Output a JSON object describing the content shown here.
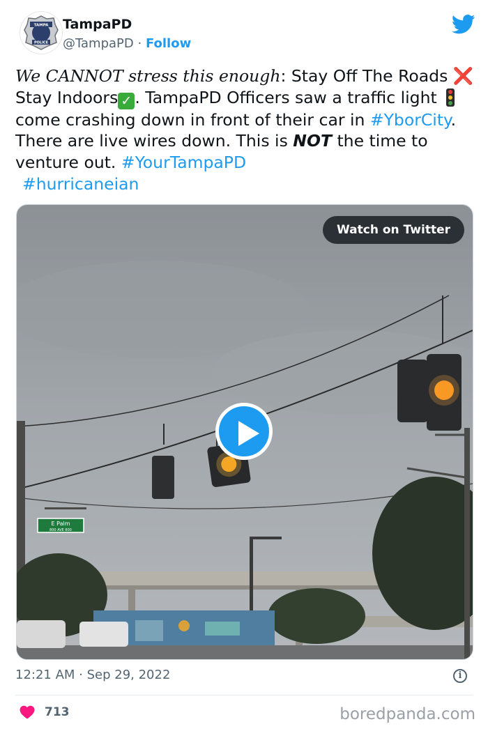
{
  "profile": {
    "name": "TampaPD",
    "handle": "@TampaPD",
    "separator": " · ",
    "follow_label": "Follow",
    "badge_top": "TAMPA",
    "badge_bottom": "POLICE"
  },
  "tweet": {
    "emphasis": "We CANNOT stress this enough",
    "part1": ": Stay Off The Roads ",
    "x_emoji": "❌",
    "part2": " Stay Indoors",
    "check_emoji": "✓",
    "part3": ". TampaPD Officers saw a traffic light ",
    "part4": " come crashing down in front of their car in ",
    "hashtag1": "#YborCity",
    "part5": ". There are live wires down. This is ",
    "not_word": "NOT",
    "part6": " the time to venture out. ",
    "hashtag2": "#YourTampaPD",
    "hashtag3": "#hurricaneian"
  },
  "media": {
    "watch_label": "Watch on Twitter",
    "street_sign": "E Palm",
    "street_sign_sub": "800 AVE 800"
  },
  "footer": {
    "timestamp": "12:21 AM · Sep 29, 2022",
    "info_glyph": "i",
    "like_count": "713",
    "watermark": "boredpanda.com"
  },
  "colors": {
    "accent": "#1d9bf0",
    "like": "#f91880",
    "text": "#0f1419",
    "secondary": "#536471"
  },
  "icons": {
    "brand": "twitter-bird-icon",
    "play": "play-icon",
    "like": "heart-icon",
    "info": "info-icon"
  }
}
